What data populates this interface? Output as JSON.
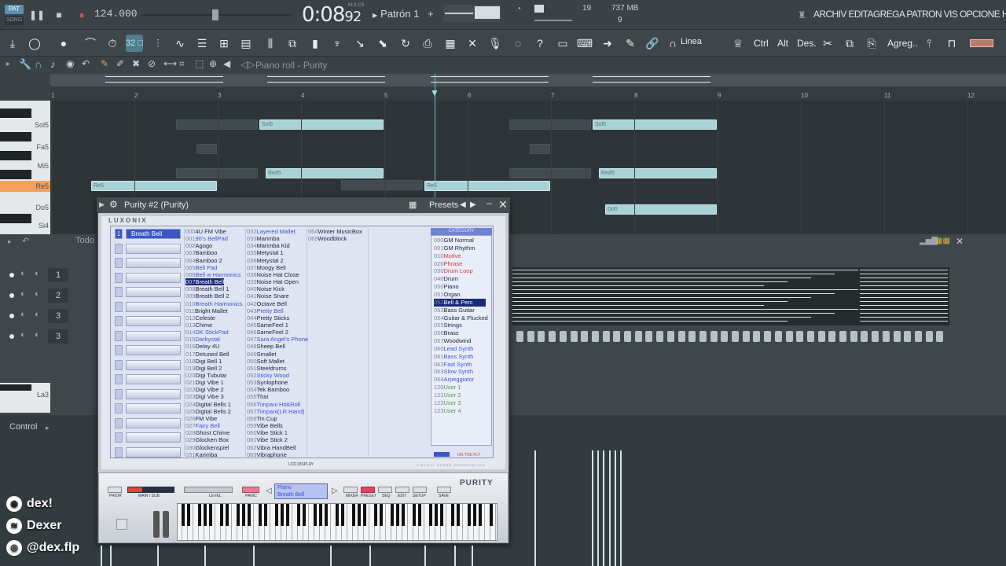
{
  "topbar": {
    "pat_badge": "PAT",
    "song_badge": "SONG",
    "tempo": "124.000",
    "clock": "0:08",
    "clock_ms": "92",
    "clock_unit": "M:S:CS",
    "pattern": "Patrón 1",
    "cpu": "19",
    "memory": "737 MB",
    "polyphony": "9",
    "menu": "ARCHIV EDITAGREGA PATRON  VIS OPCIONE HERRAMIEN"
  },
  "toolbar": {
    "snap_label": "Linea",
    "ctrl_label": "Ctrl",
    "alt_label": "Alt",
    "des_label": "Des.",
    "agreg_label": "Agreg..",
    "active_tool": "32 □"
  },
  "piano_roll": {
    "title": "Piano roll - Purity",
    "bars": [
      "1",
      "2",
      "3",
      "4",
      "5",
      "6",
      "7",
      "8",
      "9",
      "10",
      "11",
      "12"
    ],
    "keys": [
      {
        "label": "Sol5"
      },
      {
        "label": "Fa5"
      },
      {
        "label": "Mi5"
      },
      {
        "label": "Re5"
      },
      {
        "label": "Do5"
      },
      {
        "label": "Si4"
      }
    ],
    "notes": [
      {
        "label": "Sol5"
      },
      {
        "label": "Sol5"
      },
      {
        "label": "Re#5"
      },
      {
        "label": "Re#5"
      },
      {
        "label": "Re5"
      },
      {
        "label": "Re5"
      },
      {
        "label": "Do5"
      }
    ]
  },
  "channel_rack": {
    "filter_label": "Todo",
    "channels": [
      "1",
      "2",
      "3",
      "3"
    ],
    "lower_key": "La3"
  },
  "lower_editor": {
    "control_label": "Control"
  },
  "plugin": {
    "title": "Purity #2 (Purity)",
    "presets_label": "Presets",
    "brand": "LUXONIX",
    "slot1_name": "Breath Bell",
    "slot1_num": "1",
    "program_columns": [
      [
        {
          "n": "000",
          "t": "4U FM Vibe",
          "s": ""
        },
        {
          "n": "001",
          "t": "90's BellPad",
          "s": "blue"
        },
        {
          "n": "002",
          "t": "Agogo",
          "s": ""
        },
        {
          "n": "003",
          "t": "Bamboo",
          "s": ""
        },
        {
          "n": "004",
          "t": "Bamboo 2",
          "s": ""
        },
        {
          "n": "005",
          "t": "Bell Pad",
          "s": "blue"
        },
        {
          "n": "006",
          "t": "Bell w Harmonics",
          "s": "blue"
        },
        {
          "n": "007",
          "t": "Breath Bell",
          "s": "sel"
        },
        {
          "n": "008",
          "t": "Breath Bell 1",
          "s": ""
        },
        {
          "n": "009",
          "t": "Breath Bell 2",
          "s": ""
        },
        {
          "n": "010",
          "t": "Breath Harmonics",
          "s": "blue"
        },
        {
          "n": "011",
          "t": "Bright Mallet",
          "s": ""
        },
        {
          "n": "012",
          "t": "Celeste",
          "s": ""
        },
        {
          "n": "013",
          "t": "Chime",
          "s": ""
        },
        {
          "n": "014",
          "t": "DK StickPad",
          "s": "blue"
        },
        {
          "n": "015",
          "t": "Darkystal",
          "s": "blue"
        },
        {
          "n": "016",
          "t": "Delay 4U",
          "s": ""
        },
        {
          "n": "017",
          "t": "Detuned Bell",
          "s": ""
        },
        {
          "n": "018",
          "t": "Digi Bell 1",
          "s": ""
        },
        {
          "n": "019",
          "t": "Digi Bell 2",
          "s": ""
        },
        {
          "n": "020",
          "t": "Digi Tubular",
          "s": ""
        },
        {
          "n": "021",
          "t": "Digi Vibe 1",
          "s": ""
        },
        {
          "n": "022",
          "t": "Digi Vibe 2",
          "s": ""
        },
        {
          "n": "023",
          "t": "Digi Vibe 3",
          "s": ""
        },
        {
          "n": "024",
          "t": "Digital Bells 1",
          "s": ""
        },
        {
          "n": "025",
          "t": "Digital Bells 2",
          "s": ""
        },
        {
          "n": "026",
          "t": "FM Vibe",
          "s": ""
        },
        {
          "n": "027",
          "t": "Fairy Bell",
          "s": "blue"
        },
        {
          "n": "028",
          "t": "Ghost Chime",
          "s": ""
        },
        {
          "n": "029",
          "t": "Glocken Box",
          "s": ""
        },
        {
          "n": "030",
          "t": "Glockenspiel",
          "s": ""
        },
        {
          "n": "031",
          "t": "Karimba",
          "s": ""
        }
      ],
      [
        {
          "n": "032",
          "t": "Layered Mallet",
          "s": "blue"
        },
        {
          "n": "033",
          "t": "Marimba",
          "s": ""
        },
        {
          "n": "034",
          "t": "Marimba Kid",
          "s": ""
        },
        {
          "n": "035",
          "t": "Metystal 1",
          "s": ""
        },
        {
          "n": "036",
          "t": "Metystal 2",
          "s": ""
        },
        {
          "n": "037",
          "t": "Moogy Bell",
          "s": ""
        },
        {
          "n": "038",
          "t": "Noise Hat Close",
          "s": ""
        },
        {
          "n": "039",
          "t": "Noise Hat Open",
          "s": ""
        },
        {
          "n": "040",
          "t": "Noise Kick",
          "s": ""
        },
        {
          "n": "041",
          "t": "Noise Snare",
          "s": ""
        },
        {
          "n": "042",
          "t": "Octave Bell",
          "s": ""
        },
        {
          "n": "043",
          "t": "Pretty Bell",
          "s": "blue"
        },
        {
          "n": "044",
          "t": "Pretty Sticks",
          "s": ""
        },
        {
          "n": "045",
          "t": "SameFeel 1",
          "s": ""
        },
        {
          "n": "046",
          "t": "SameFeel 2",
          "s": ""
        },
        {
          "n": "047",
          "t": "Sara Angel's Phone",
          "s": "blue"
        },
        {
          "n": "048",
          "t": "Sheep Bell",
          "s": ""
        },
        {
          "n": "049",
          "t": "Smallet",
          "s": ""
        },
        {
          "n": "050",
          "t": "Soft Mallet",
          "s": ""
        },
        {
          "n": "051",
          "t": "Steeldrums",
          "s": ""
        },
        {
          "n": "052",
          "t": "Sticky Wood",
          "s": "blue"
        },
        {
          "n": "053",
          "t": "Synlophone",
          "s": ""
        },
        {
          "n": "054",
          "t": "Tek Bamboo",
          "s": ""
        },
        {
          "n": "055",
          "t": "Thai",
          "s": ""
        },
        {
          "n": "056",
          "t": "Timpani Hit&Roll",
          "s": "blue"
        },
        {
          "n": "057",
          "t": "Timpani(LR Hand)",
          "s": "blue"
        },
        {
          "n": "058",
          "t": "Tin Cup",
          "s": ""
        },
        {
          "n": "059",
          "t": "Vibe Bells",
          "s": ""
        },
        {
          "n": "060",
          "t": "Vibe Stick 1",
          "s": ""
        },
        {
          "n": "061",
          "t": "Vibe Stick 2",
          "s": ""
        },
        {
          "n": "062",
          "t": "Vibra HandBell",
          "s": ""
        },
        {
          "n": "063",
          "t": "Vibraphone",
          "s": ""
        }
      ],
      [
        {
          "n": "064",
          "t": "Winter MusicBox",
          "s": ""
        },
        {
          "n": "065",
          "t": "Woodblock",
          "s": ""
        }
      ]
    ],
    "category_header": "CATEGORY",
    "categories": [
      {
        "n": "000",
        "t": "GM Normal",
        "s": ""
      },
      {
        "n": "001",
        "t": "GM Rhythm",
        "s": ""
      },
      {
        "n": "010",
        "t": "Motive",
        "s": "red"
      },
      {
        "n": "020",
        "t": "Phrase",
        "s": "red"
      },
      {
        "n": "030",
        "t": "Drum Loop",
        "s": "red"
      },
      {
        "n": "040",
        "t": "Drum",
        "s": ""
      },
      {
        "n": "050",
        "t": "Piano",
        "s": ""
      },
      {
        "n": "051",
        "t": "Organ",
        "s": ""
      },
      {
        "n": "052",
        "t": "Bell & Perc",
        "s": "sel"
      },
      {
        "n": "053",
        "t": "Bass Guitar",
        "s": ""
      },
      {
        "n": "054",
        "t": "Guitar & Plucked",
        "s": ""
      },
      {
        "n": "055",
        "t": "Strings",
        "s": ""
      },
      {
        "n": "056",
        "t": "Brass",
        "s": ""
      },
      {
        "n": "057",
        "t": "Woodwind",
        "s": ""
      },
      {
        "n": "060",
        "t": "Lead Synth",
        "s": "blue"
      },
      {
        "n": "061",
        "t": "Bass Synth",
        "s": "blue"
      },
      {
        "n": "062",
        "t": "Fast Synth",
        "s": "blue"
      },
      {
        "n": "063",
        "t": "Slow Synth",
        "s": "blue"
      },
      {
        "n": "064",
        "t": "Arpeggiator",
        "s": "blue"
      },
      {
        "n": "120",
        "t": "User 1",
        "s": "green"
      },
      {
        "n": "121",
        "t": "User 2",
        "s": "green"
      },
      {
        "n": "122",
        "t": "User 3",
        "s": "green"
      },
      {
        "n": "123",
        "t": "User 4",
        "s": "green"
      }
    ],
    "on_the_fly": "ON THE FLY",
    "lcd_label": "LCD DISPLAY",
    "vsw_label": "VIRTUAL SOUND WORKSTATION",
    "product_name": "PURITY",
    "ctrl": {
      "prior": "PRIOR",
      "main_sub": "MAIN / SUB",
      "level": "LEVEL",
      "panic": "PANIC",
      "mixer": "MIXER",
      "preset": "PRESET",
      "seq": "SEQ",
      "edit": "EDIT",
      "setup": "SETUP",
      "save": "SAVE"
    },
    "program_display": {
      "category": "Piano",
      "program": "Breath Bell"
    }
  },
  "social": {
    "discord": "dex!",
    "spotify": "Dexer",
    "instagram": "@dex.flp"
  },
  "colors": {
    "accent": "#4f7d8d",
    "note": "#a8d3d6",
    "key_highlight": "#f3a15c",
    "selection": "#1a2a7a"
  }
}
